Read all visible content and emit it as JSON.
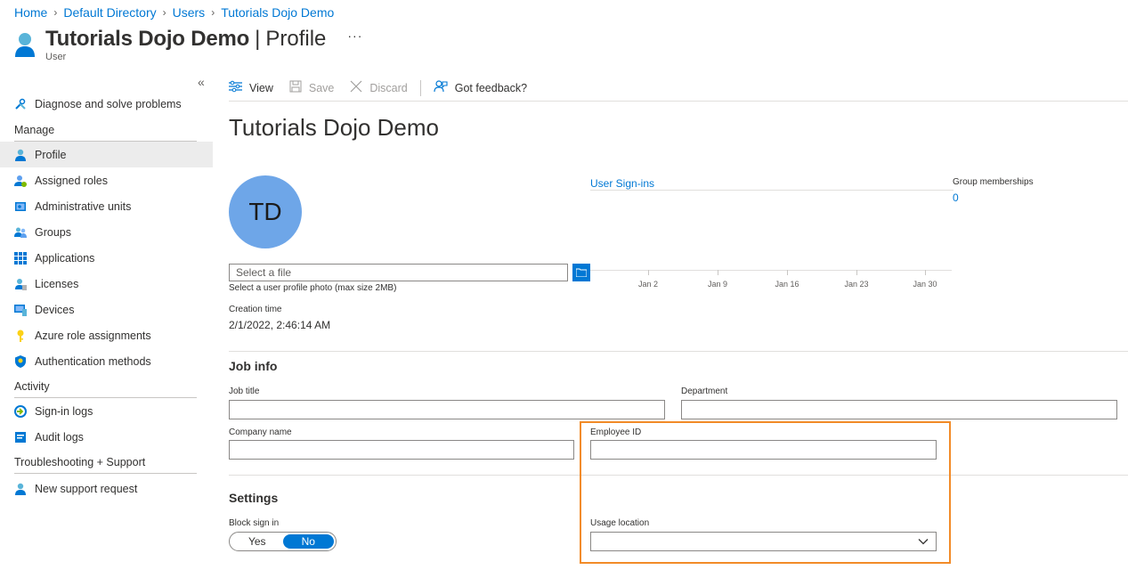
{
  "breadcrumb": [
    "Home",
    "Default Directory",
    "Users",
    "Tutorials Dojo Demo"
  ],
  "header": {
    "title": "Tutorials Dojo Demo",
    "separator": "|",
    "subtitle": "Profile",
    "more": "···",
    "type": "User"
  },
  "sidebar": {
    "collapse": "«",
    "top_items": [
      {
        "label": "Diagnose and solve problems",
        "icon": "wrench-icon"
      }
    ],
    "sections": [
      {
        "title": "Manage",
        "items": [
          {
            "label": "Profile",
            "icon": "user-icon",
            "active": true
          },
          {
            "label": "Assigned roles",
            "icon": "user-role-icon"
          },
          {
            "label": "Administrative units",
            "icon": "admin-units-icon"
          },
          {
            "label": "Groups",
            "icon": "groups-icon"
          },
          {
            "label": "Applications",
            "icon": "apps-grid-icon"
          },
          {
            "label": "Licenses",
            "icon": "license-icon"
          },
          {
            "label": "Devices",
            "icon": "device-icon"
          },
          {
            "label": "Azure role assignments",
            "icon": "key-icon"
          },
          {
            "label": "Authentication methods",
            "icon": "shield-icon"
          }
        ]
      },
      {
        "title": "Activity",
        "items": [
          {
            "label": "Sign-in logs",
            "icon": "signin-log-icon"
          },
          {
            "label": "Audit logs",
            "icon": "audit-log-icon"
          }
        ]
      },
      {
        "title": "Troubleshooting + Support",
        "items": [
          {
            "label": "New support request",
            "icon": "support-icon"
          }
        ]
      }
    ]
  },
  "toolbar": {
    "view": "View",
    "save": "Save",
    "discard": "Discard",
    "feedback": "Got feedback?"
  },
  "main": {
    "title": "Tutorials Dojo Demo",
    "avatar_initials": "TD",
    "avatar_color": "#6ea6e8",
    "file_placeholder": "Select a file",
    "file_hint": "Select a user profile photo (max size 2MB)",
    "creation_label": "Creation time",
    "creation_value": "2/1/2022, 2:46:14 AM",
    "signins_link": "User Sign-ins",
    "signins_ticks": [
      "Jan 2",
      "Jan 9",
      "Jan 16",
      "Jan 23",
      "Jan 30"
    ],
    "group_label": "Group memberships",
    "group_count": "0"
  },
  "job_info": {
    "title": "Job info",
    "job_title_label": "Job title",
    "department_label": "Department",
    "company_label": "Company name",
    "employee_id_label": "Employee ID"
  },
  "settings": {
    "title": "Settings",
    "block_label": "Block sign in",
    "yes": "Yes",
    "no": "No",
    "block_value": "No",
    "usage_label": "Usage location"
  },
  "colors": {
    "accent": "#0078d4",
    "highlight": "#f28b28"
  }
}
